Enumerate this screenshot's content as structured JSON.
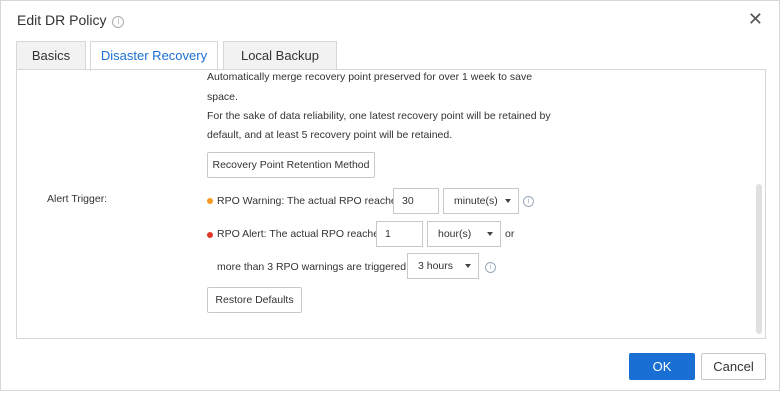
{
  "dialog": {
    "title": "Edit DR Policy",
    "close": "✕"
  },
  "tabs": [
    "Basics",
    "Disaster Recovery",
    "Local Backup"
  ],
  "retention": {
    "line1": "Automatically merge recovery point preserved for over 1 week to save",
    "line2": "space.",
    "line3": "For the sake of data reliability, one latest recovery point will be retained by",
    "line4": "default, and at least 5 recovery point will be retained.",
    "method_button": "Recovery Point Retention Method"
  },
  "alert": {
    "label": "Alert Trigger:",
    "warning_text": "RPO Warning: The actual RPO reaches",
    "warning_value": "30",
    "warning_unit": "minute(s)",
    "alert_text": "RPO Alert: The actual RPO reaches",
    "alert_value": "1",
    "alert_unit": "hour(s)",
    "or": "or",
    "more_text": "more than 3 RPO warnings are triggered in",
    "more_value": "3 hours",
    "restore_button": "Restore Defaults"
  },
  "footer": {
    "ok": "OK",
    "cancel": "Cancel"
  },
  "colors": {
    "accent": "#1a6fd4",
    "warning_dot": "#f59a23",
    "alert_dot": "#e0392b"
  }
}
